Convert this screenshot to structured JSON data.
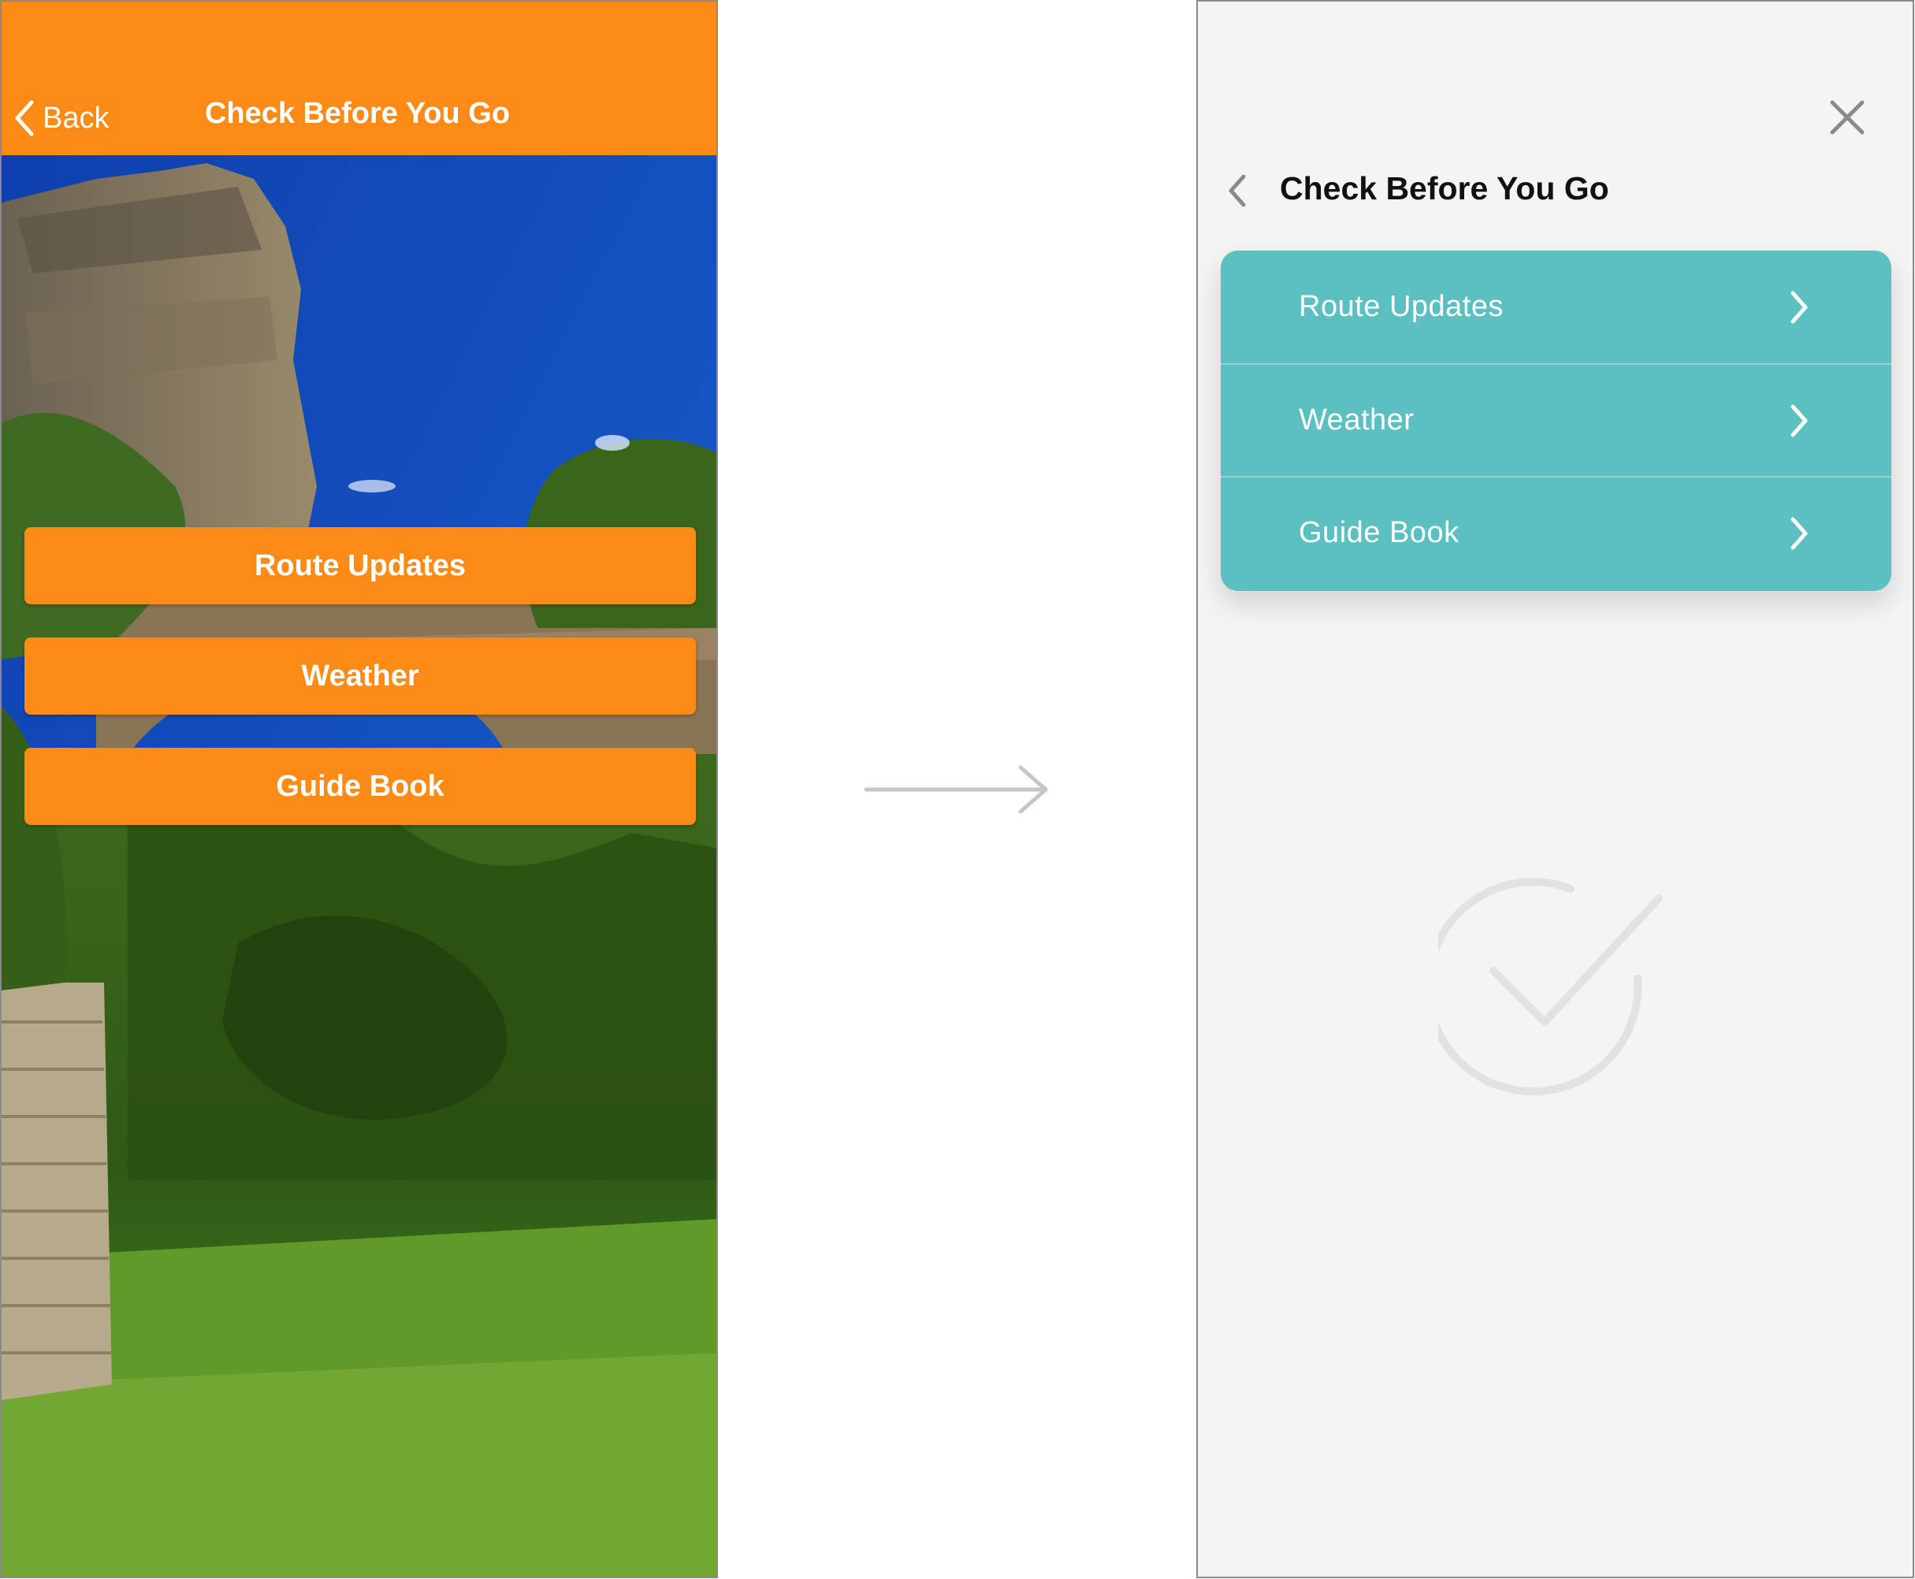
{
  "before": {
    "header": {
      "back_label": "Back",
      "title": "Check Before You Go"
    },
    "buttons": [
      {
        "label": "Route Updates"
      },
      {
        "label": "Weather"
      },
      {
        "label": "Guide Book"
      }
    ],
    "colors": {
      "accent": "#fb8a17",
      "text": "#ffffff"
    }
  },
  "after": {
    "title": "Check Before You Go",
    "list": [
      {
        "label": "Route Updates"
      },
      {
        "label": "Weather"
      },
      {
        "label": "Guide Book"
      }
    ],
    "icons": {
      "close": "close-icon",
      "back": "chevron-left-icon",
      "item": "chevron-right-icon",
      "status": "check-circle-icon"
    },
    "colors": {
      "accent": "#5bc0bf",
      "background": "#f4f4f4",
      "text": "#ffffff",
      "title": "#111111"
    }
  }
}
